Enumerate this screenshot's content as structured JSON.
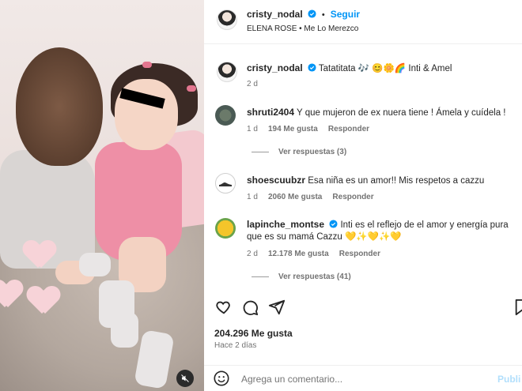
{
  "post": {
    "author": "cristy_nodal",
    "follow_label": "Seguir",
    "audio": {
      "artist": "ELENA ROSE",
      "song": "Me Lo Merezco"
    },
    "caption": {
      "username": "cristy_nodal",
      "text": "Tatatitata 🎶 😊🌼🌈 Inti & Amel",
      "time": "2 d"
    }
  },
  "comments": [
    {
      "username": "shruti2404",
      "text": "Y que mujeron de ex nuera tiene ! Ámela y cuídela !",
      "time": "1 d",
      "likes": "194 Me gusta",
      "reply": "Responder",
      "view_replies": "Ver respuestas (3)"
    },
    {
      "username": "shoescuubzr",
      "text": "Esa niña es un amor!! Mis respetos a cazzu",
      "time": "1 d",
      "likes": "2060 Me gusta",
      "reply": "Responder"
    },
    {
      "username": "lapinche_montse",
      "text_line1": "Inti es el reflejo de el amor y energía pura",
      "text_line2": "que es su mamá Cazzu 💛✨💛✨💛",
      "time": "2 d",
      "likes": "12.178 Me gusta",
      "reply": "Responder",
      "view_replies": "Ver respuestas (41)"
    }
  ],
  "stats": {
    "likes": "204.296 Me gusta",
    "date": "Hace 2 días"
  },
  "comment_box": {
    "placeholder": "Agrega un comentario...",
    "publish_label": "Publi"
  },
  "colors": {
    "accent": "#0095f6",
    "verified": "#0095f6",
    "text": "#262626",
    "muted": "#737373"
  }
}
